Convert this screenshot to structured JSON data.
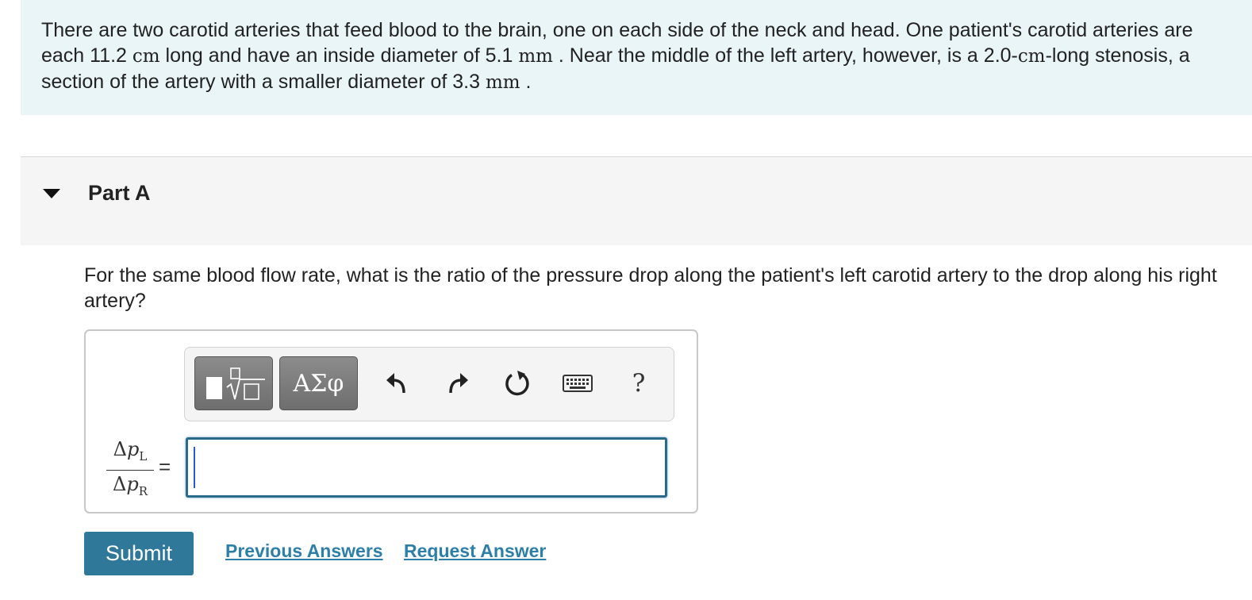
{
  "problem": {
    "seg1": "There are two carotid arteries that feed blood to the brain, one on each side of the neck and head. One patient's carotid arteries are each 11.2 ",
    "unit_cm": "cm",
    "seg2": " long and have an inside diameter of 5.1 ",
    "unit_mm_1": "mm",
    "seg3": " . Near the middle of the left artery, however, is a 2.0-",
    "unit_cm_2": "cm",
    "seg4": "-long stenosis, a section of the artery with a smaller diameter of 3.3 ",
    "unit_mm_2": "mm",
    "seg5": " ."
  },
  "part": {
    "title": "Part A"
  },
  "question": "For the same blood flow rate, what is the ratio of the pressure drop along the patient's left carotid artery to the drop along his right artery?",
  "toolbar": {
    "symbols_label": "ΑΣφ",
    "help_label": "?",
    "icons": [
      "templates-icon",
      "greek-symbols-icon",
      "undo-icon",
      "redo-icon",
      "reset-icon",
      "keyboard-icon",
      "help-icon"
    ]
  },
  "fraction": {
    "num_delta": "Δ",
    "num_var": "p",
    "num_sub": "L",
    "den_delta": "Δ",
    "den_var": "p",
    "den_sub": "R"
  },
  "equals": "=",
  "answer_value": "",
  "buttons": {
    "submit": "Submit",
    "previous": "Previous Answers",
    "request": "Request Answer"
  },
  "colors": {
    "problem_bg": "#eaf5f7",
    "submit_bg": "#2f7899",
    "link": "#2c7fa8",
    "input_border": "#2a6b8c"
  }
}
